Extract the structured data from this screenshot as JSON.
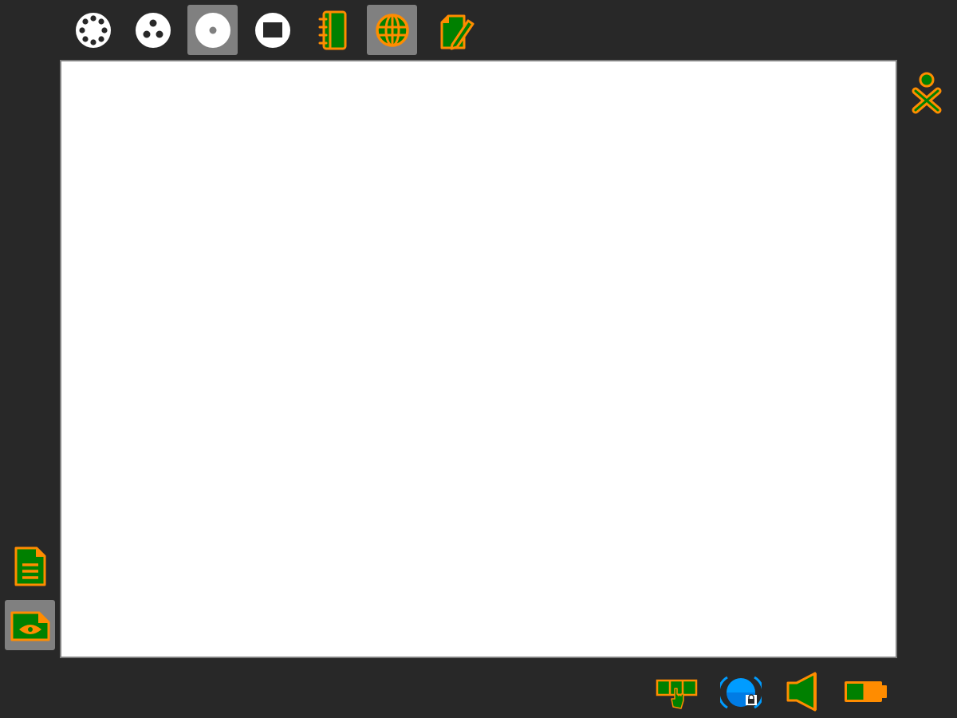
{
  "colors": {
    "frame_background": "#282828",
    "selected_background": "#808080",
    "stroke": "#FF8C00",
    "fill": "#008000",
    "white": "#FFFFFF",
    "canvas": "#FFFFFF",
    "network": "#009CFF"
  },
  "top_panel": {
    "items": [
      {
        "name": "neighborhood-view",
        "icon": "neighborhood-icon",
        "selected": false
      },
      {
        "name": "group-view",
        "icon": "group-icon",
        "selected": false
      },
      {
        "name": "home-view",
        "icon": "home-icon",
        "selected": true
      },
      {
        "name": "activity-view",
        "icon": "activity-icon",
        "selected": false
      },
      {
        "name": "journal",
        "icon": "journal-icon",
        "selected": false
      },
      {
        "name": "browse-activity",
        "icon": "browse-icon",
        "selected": true
      },
      {
        "name": "write-activity",
        "icon": "write-icon",
        "selected": false
      }
    ]
  },
  "right_panel": {
    "buddy_icon": "xo-buddy-icon"
  },
  "left_panel": {
    "items": [
      {
        "name": "document-entry",
        "icon": "document-icon",
        "selected": false
      },
      {
        "name": "view-source-entry",
        "icon": "view-source-icon",
        "selected": true
      }
    ]
  },
  "bottom_panel": {
    "devices": [
      {
        "name": "touchpad-device",
        "icon": "touchpad-icon"
      },
      {
        "name": "network-device",
        "icon": "network-icon"
      },
      {
        "name": "volume-device",
        "icon": "speaker-icon"
      },
      {
        "name": "battery-device",
        "icon": "battery-icon",
        "level": 0.5
      }
    ]
  }
}
